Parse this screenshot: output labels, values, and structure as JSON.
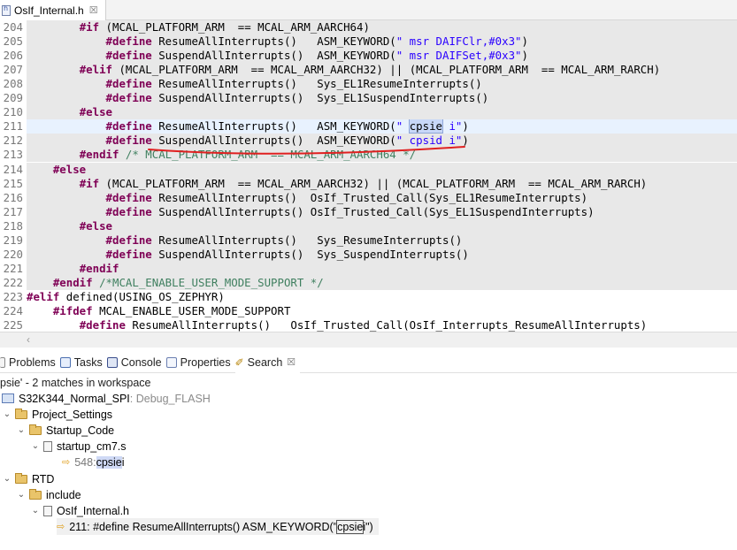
{
  "editor": {
    "tab_label": "OsIf_Internal.h",
    "tab_close": "☒"
  },
  "code_lines": [
    {
      "n": "204",
      "parts": [
        [
          "pl",
          "        "
        ],
        [
          "kw",
          "#if"
        ],
        [
          "pl",
          " (MCAL_PLATFORM_ARM  == MCAL_ARM_AARCH64)"
        ]
      ]
    },
    {
      "n": "205",
      "parts": [
        [
          "pl",
          "            "
        ],
        [
          "kw",
          "#define"
        ],
        [
          "pl",
          " ResumeAllInterrupts()   ASM_KEYWORD("
        ],
        [
          "str",
          "\" msr DAIFClr,#0x3\""
        ],
        [
          "pl",
          ")"
        ]
      ]
    },
    {
      "n": "206",
      "parts": [
        [
          "pl",
          "            "
        ],
        [
          "kw",
          "#define"
        ],
        [
          "pl",
          " SuspendAllInterrupts()  ASM_KEYWORD("
        ],
        [
          "str",
          "\" msr DAIFSet,#0x3\""
        ],
        [
          "pl",
          ")"
        ]
      ]
    },
    {
      "n": "207",
      "parts": [
        [
          "pl",
          "        "
        ],
        [
          "kw",
          "#elif"
        ],
        [
          "pl",
          " (MCAL_PLATFORM_ARM  == MCAL_ARM_AARCH32) || (MCAL_PLATFORM_ARM  == MCAL_ARM_RARCH)"
        ]
      ]
    },
    {
      "n": "208",
      "parts": [
        [
          "pl",
          "            "
        ],
        [
          "kw",
          "#define"
        ],
        [
          "pl",
          " ResumeAllInterrupts()   Sys_EL1ResumeInterrupts()"
        ]
      ]
    },
    {
      "n": "209",
      "parts": [
        [
          "pl",
          "            "
        ],
        [
          "kw",
          "#define"
        ],
        [
          "pl",
          " SuspendAllInterrupts()  Sys_EL1SuspendInterrupts()"
        ]
      ]
    },
    {
      "n": "210",
      "parts": [
        [
          "pl",
          "        "
        ],
        [
          "kw",
          "#else"
        ]
      ]
    },
    {
      "n": "211",
      "parts": [
        [
          "pl",
          "            "
        ],
        [
          "kw",
          "#define"
        ],
        [
          "pl",
          " ResumeAllInterrupts()   ASM_KEYWORD("
        ],
        [
          "str",
          "\" "
        ],
        [
          "hl",
          "cpsie"
        ],
        [
          "str",
          " i\""
        ],
        [
          "pl",
          ")"
        ]
      ]
    },
    {
      "n": "212",
      "parts": [
        [
          "pl",
          "            "
        ],
        [
          "kw",
          "#define"
        ],
        [
          "pl",
          " SuspendAllInterrupts()  ASM_KEYWORD("
        ],
        [
          "str",
          "\" cpsid i\""
        ],
        [
          "pl",
          ")"
        ]
      ]
    },
    {
      "n": "213",
      "parts": [
        [
          "pl",
          "        "
        ],
        [
          "kw",
          "#endif"
        ],
        [
          "cmt",
          " /* MCAL_PLATFORM_ARM  == MCAL_ARM_AARCH64 */"
        ]
      ]
    },
    {
      "n": "214",
      "parts": [
        [
          "pl",
          "    "
        ],
        [
          "kw",
          "#else"
        ]
      ]
    },
    {
      "n": "215",
      "parts": [
        [
          "pl",
          "        "
        ],
        [
          "kw",
          "#if"
        ],
        [
          "pl",
          " (MCAL_PLATFORM_ARM  == MCAL_ARM_AARCH32) || (MCAL_PLATFORM_ARM  == MCAL_ARM_RARCH)"
        ]
      ]
    },
    {
      "n": "216",
      "parts": [
        [
          "pl",
          "            "
        ],
        [
          "kw",
          "#define"
        ],
        [
          "pl",
          " ResumeAllInterrupts()  OsIf_Trusted_Call(Sys_EL1ResumeInterrupts)"
        ]
      ]
    },
    {
      "n": "217",
      "parts": [
        [
          "pl",
          "            "
        ],
        [
          "kw",
          "#define"
        ],
        [
          "pl",
          " SuspendAllInterrupts() OsIf_Trusted_Call(Sys_EL1SuspendInterrupts)"
        ]
      ]
    },
    {
      "n": "218",
      "parts": [
        [
          "pl",
          "        "
        ],
        [
          "kw",
          "#else"
        ]
      ]
    },
    {
      "n": "219",
      "parts": [
        [
          "pl",
          "            "
        ],
        [
          "kw",
          "#define"
        ],
        [
          "pl",
          " ResumeAllInterrupts()   Sys_ResumeInterrupts()"
        ]
      ]
    },
    {
      "n": "220",
      "parts": [
        [
          "pl",
          "            "
        ],
        [
          "kw",
          "#define"
        ],
        [
          "pl",
          " SuspendAllInterrupts()  Sys_SuspendInterrupts()"
        ]
      ]
    },
    {
      "n": "221",
      "parts": [
        [
          "pl",
          "        "
        ],
        [
          "kw",
          "#endif"
        ]
      ]
    },
    {
      "n": "222",
      "parts": [
        [
          "pl",
          "    "
        ],
        [
          "kw",
          "#endif"
        ],
        [
          "cmt",
          " /*MCAL_ENABLE_USER_MODE_SUPPORT */"
        ]
      ]
    },
    {
      "n": "223",
      "parts": [
        [
          "kw",
          "#elif"
        ],
        [
          "pl",
          " defined(USING_OS_ZEPHYR)"
        ]
      ]
    },
    {
      "n": "224",
      "parts": [
        [
          "pl",
          "    "
        ],
        [
          "kw",
          "#ifdef"
        ],
        [
          "pl",
          " MCAL_ENABLE_USER_MODE_SUPPORT"
        ]
      ]
    },
    {
      "n": "225",
      "parts": [
        [
          "pl",
          "        "
        ],
        [
          "kw",
          "#define"
        ],
        [
          "pl",
          " ResumeAllInterrupts()   OsIf_Trusted_Call(OsIf_Interrupts_ResumeAllInterrupts)"
        ]
      ]
    }
  ],
  "view_tabs": [
    {
      "label": "Problems",
      "icon": "problems-icon"
    },
    {
      "label": "Tasks",
      "icon": "tasks-icon"
    },
    {
      "label": "Console",
      "icon": "console-icon"
    },
    {
      "label": "Properties",
      "icon": "properties-icon"
    },
    {
      "label": "Search",
      "icon": "search-icon",
      "close": "☒"
    }
  ],
  "search": {
    "summary": "psie' - 2 matches in workspace",
    "project_name": "S32K344_Normal_SPI",
    "project_config": ": Debug_FLASH",
    "folder_project_settings": "Project_Settings",
    "folder_startup_code": "Startup_Code",
    "file_startup": "startup_cm7.s",
    "match1_prefix": "548: ",
    "match1_hit": "cpsie",
    "match1_suffix": " i",
    "folder_rtd": "RTD",
    "folder_include": "include",
    "file_osif": "OsIf_Internal.h",
    "match2_prefix": "211: #define ResumeAllInterrupts()   ASM_KEYWORD(\" ",
    "match2_hit": "cpsie",
    "match2_suffix": " i\")"
  },
  "colors": {
    "keyword": "#7f0055",
    "string": "#2a00ff",
    "comment": "#3f7f5f",
    "annotation": "#e02020"
  }
}
